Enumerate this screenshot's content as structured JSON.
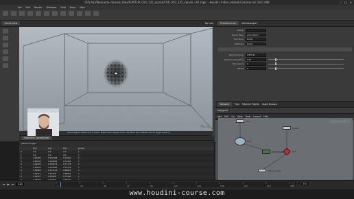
{
  "window": {
    "title": "[ATLAS]/Work/edu-rb/work_files/FUP/FUP_010_135_splash/FUP_010_135_splash_v01.hiplc - Houdini Indie Limited-Commercial 18.0.499"
  },
  "menubar": [
    "File",
    "Edit",
    "Render",
    "Windows",
    "Help",
    "Build",
    "Main"
  ],
  "viewport": {
    "pane_label": "Scene View",
    "camera_label": "No cam",
    "status": "Select objects. Middle-click to select. Right-click to display menu. Use Tab to add. Shift/Ctrl click to toggle selection.",
    "perspective_label": "Persp"
  },
  "spreadsheet": {
    "title": "Geometry Spreadsheet",
    "node": "attribwrangle1",
    "columns": [
      "",
      "P[x]",
      "P[y]",
      "P[z]",
      "pscale"
    ],
    "rows": [
      [
        "0",
        "0.0",
        "0.0",
        "0.0",
        "1"
      ],
      [
        "1",
        "0.0",
        "0.0",
        "0.0",
        "1"
      ],
      [
        "2",
        "1.06362",
        "0.256464",
        "0.72631",
        "1"
      ],
      [
        "3",
        "0.58432",
        "0.160844",
        "0.74401",
        "1"
      ],
      [
        "4",
        "1.09924",
        "0.128574",
        "0.71779",
        "1"
      ],
      [
        "5",
        "1.55624",
        "0.145881",
        "0.73378",
        "1"
      ],
      [
        "6",
        "1.59802",
        "0.175113",
        "0.66821",
        "1"
      ],
      [
        "7",
        "1.36317",
        "0.10449",
        "0.66821",
        "1"
      ],
      [
        "8",
        "1.29977",
        "0.14609",
        "0.72981",
        "1"
      ],
      [
        "9",
        "1.48523",
        "0.15681",
        "0.68721",
        "1"
      ]
    ]
  },
  "params": {
    "node_title": "PointGenerate",
    "node_name": "attribwrangle1",
    "rows": [
      {
        "label": "Group",
        "value": ""
      },
      {
        "label": "Group Type",
        "value": "Auto Detect"
      },
      {
        "label": "Run Over",
        "value": "Points"
      },
      {
        "label": "Attribute",
        "value": "Detail"
      },
      {
        "label": "Particle Group",
        "value": "@P*0.25"
      },
      {
        "label": "Particle Separation",
        "value": "0.05"
      },
      {
        "label": "Max Count",
        "value": "1"
      },
      {
        "label": "Offset",
        "value": "0"
      }
    ]
  },
  "network": {
    "tabs": [
      "Network",
      "Tree",
      "Material Palette",
      "Asset Browser"
    ],
    "path": "/obj/geo1",
    "menus": [
      "Add",
      "Edit",
      "Go",
      "View",
      "Tools",
      "Layout",
      "Help"
    ],
    "context": "Geometry",
    "nodes": [
      {
        "name": "box1",
        "label": "box1"
      },
      {
        "name": "scatter1",
        "label": "Scatter"
      },
      {
        "name": "fluid1",
        "label": "fluid"
      },
      {
        "name": "attribwrangle1",
        "label": "attribwrangle1"
      },
      {
        "name": "null1",
        "label": "OUT"
      },
      {
        "name": "object_merge",
        "label": "object_merge"
      }
    ]
  },
  "timeline": {
    "frame": "134",
    "start": "1",
    "end": "240",
    "ticks": [
      "1",
      "24",
      "48",
      "72",
      "96",
      "120",
      "144",
      "168",
      "192",
      "216",
      "240"
    ]
  },
  "footer": {
    "watermark": "www.houdini-course.com"
  },
  "colors": {
    "background": "#1e1e1e",
    "viewport_top": "#aeb6bd",
    "viewport_bottom": "#8e969c",
    "node_green": "#3f7f3f",
    "node_red": "#c62c2c",
    "status_text": "#9fd0ff"
  }
}
